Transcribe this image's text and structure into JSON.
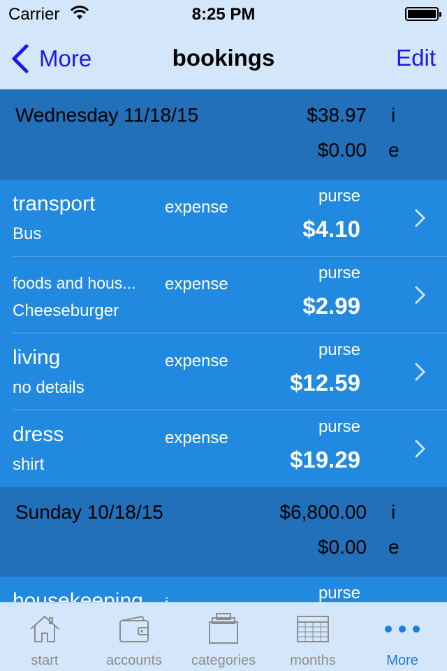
{
  "status_bar": {
    "carrier": "Carrier",
    "time": "8:25 PM"
  },
  "nav": {
    "back_label": "More",
    "title": "bookings",
    "edit_label": "Edit"
  },
  "sections": [
    {
      "date": "Wednesday 11/18/15",
      "income_total": "$38.97",
      "income_tag": "i",
      "expense_total": "$0.00",
      "expense_tag": "e",
      "rows": [
        {
          "category": "transport",
          "detail": "Bus",
          "type": "expense",
          "account": "purse",
          "amount": "$4.10"
        },
        {
          "category": "foods and hous...",
          "detail": "Cheeseburger",
          "type": "expense",
          "account": "purse",
          "amount": "$2.99"
        },
        {
          "category": "living",
          "detail": "no details",
          "type": "expense",
          "account": "purse",
          "amount": "$12.59"
        },
        {
          "category": "dress",
          "detail": "shirt",
          "type": "expense",
          "account": "purse",
          "amount": "$19.29"
        }
      ]
    },
    {
      "date": "Sunday 10/18/15",
      "income_total": "$6,800.00",
      "income_tag": "i",
      "expense_total": "$0.00",
      "expense_tag": "e",
      "rows": [
        {
          "category": "housekeeping",
          "detail": "",
          "type": "i",
          "account": "purse",
          "amount": ""
        }
      ]
    }
  ],
  "tabs": [
    {
      "label": "start",
      "icon": "house-icon"
    },
    {
      "label": "accounts",
      "icon": "wallet-icon"
    },
    {
      "label": "categories",
      "icon": "tray-icon"
    },
    {
      "label": "months",
      "icon": "grid-icon"
    },
    {
      "label": "More",
      "icon": "more-icon",
      "active": true
    }
  ],
  "colors": {
    "bar_background": "#d4e7fa",
    "section_header": "#2270b9",
    "row_background": "#2289e0",
    "link": "#1a1ae6",
    "tab_active": "#1a7de8",
    "tab_inactive": "#8c8c8c"
  }
}
